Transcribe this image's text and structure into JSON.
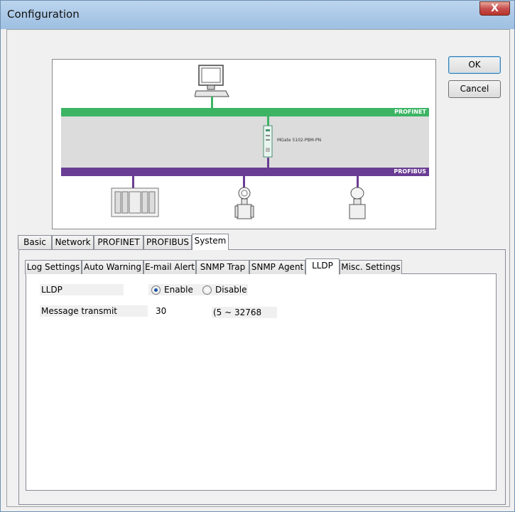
{
  "window": {
    "title": "Configuration",
    "close_glyph": "X"
  },
  "buttons": {
    "ok": "OK",
    "cancel": "Cancel"
  },
  "diagram": {
    "profinet_label": "PROFINET",
    "profibus_label": "PROFIBUS",
    "gateway_label": "MGate 5102-PBM-PN"
  },
  "outer_tabs": [
    "Basic",
    "Network",
    "PROFINET",
    "PROFIBUS",
    "System"
  ],
  "inner_tabs": [
    "Log Settings",
    "Auto Warning",
    "E-mail Alert",
    "SNMP Trap",
    "SNMP Agent",
    "LLDP",
    "Misc. Settings"
  ],
  "lldp": {
    "label": "LLDP",
    "enable": "Enable",
    "disable": "Disable",
    "selected": "Enable"
  },
  "message_transmit": {
    "label": "Message transmit",
    "value": "30",
    "range": "(5 ~ 32768"
  },
  "colors": {
    "profinet": "#3cb464",
    "profibus": "#6a3d94"
  }
}
